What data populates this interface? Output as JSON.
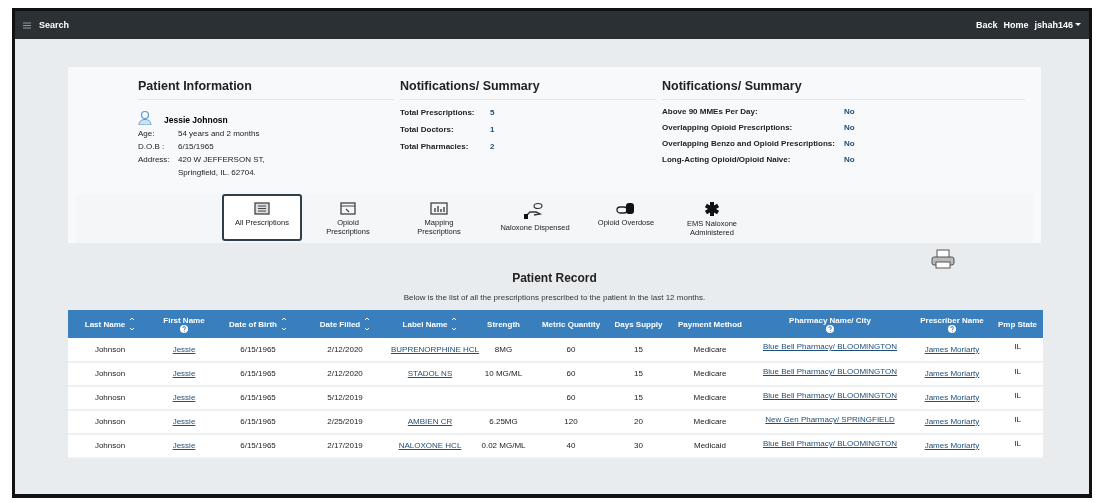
{
  "navbar": {
    "menu_label": "Search",
    "links": [
      "Back",
      "Home"
    ],
    "user": "jshah146"
  },
  "patient": {
    "title": "Patient Information",
    "name": "Jessie Johnosn",
    "fields": [
      {
        "label": "Age:",
        "value": "54 years and 2 months"
      },
      {
        "label": "D.O.B :",
        "value": "6/15/1965"
      },
      {
        "label": "Address:",
        "value": "420 W JEFFERSON ST,",
        "value_2": "Springfield, IL. 62704."
      }
    ]
  },
  "summary": {
    "title": "Notifications/ Summary",
    "items": [
      {
        "label": "Total Prescriptions:",
        "value": "5"
      },
      {
        "label": "Total Doctors:",
        "value": "1"
      },
      {
        "label": "Total Pharmacies:",
        "value": "2"
      }
    ]
  },
  "notifications": {
    "title": "Notifications/ Summary",
    "items": [
      {
        "label": "Above 90 MMEs Per Day:",
        "value": "No"
      },
      {
        "label": "Overlapping Opioid Prescriptions:",
        "value": "No"
      },
      {
        "label": "Overlapping Benzo and Opioid Prescriptions:",
        "value": "No"
      },
      {
        "label": "Long-Acting Opioid/Opioid Naive:",
        "value": "No"
      }
    ]
  },
  "tabs": [
    {
      "kind": "list",
      "label": "All Prescriptions",
      "selected": true
    },
    {
      "kind": "opioid",
      "label": "Opioid Prescriptions",
      "selected": false
    },
    {
      "kind": "map",
      "label": "Mapping Prescriptions",
      "selected": false
    },
    {
      "kind": "naloxone",
      "label": "Naloxone Dispensed",
      "selected": false
    },
    {
      "kind": "overdose",
      "label": "Opioid Overdose",
      "selected": false
    },
    {
      "kind": "ems",
      "label": "EMS Naloxone Administered",
      "selected": false
    }
  ],
  "record": {
    "title": "Patient Record",
    "subtitle": "Below is the list of all the prescriptions prescribed to the patient in the last 12 months."
  },
  "table": {
    "columns": [
      {
        "label": "Last Name",
        "sortable": true,
        "help": false,
        "link": false
      },
      {
        "label": "First Name",
        "sortable": false,
        "help": true,
        "link": true
      },
      {
        "label": "Date of Birth",
        "sortable": true,
        "help": false,
        "link": false
      },
      {
        "label": "Date Filled",
        "sortable": true,
        "help": false,
        "link": false
      },
      {
        "label": "Label Name",
        "sortable": true,
        "help": false,
        "link": true
      },
      {
        "label": "Strength",
        "sortable": false,
        "help": false,
        "link": false
      },
      {
        "label": "Metric Quantity",
        "sortable": false,
        "help": false,
        "link": false
      },
      {
        "label": "Days Supply",
        "sortable": false,
        "help": false,
        "link": false
      },
      {
        "label": "Payment Method",
        "sortable": false,
        "help": false,
        "link": false
      },
      {
        "label": "Pharmacy Name/ City",
        "sortable": false,
        "help": true,
        "link": true
      },
      {
        "label": "Prescriber Name",
        "sortable": false,
        "help": true,
        "link": true
      },
      {
        "label": "Pmp State",
        "sortable": false,
        "help": false,
        "link": false
      }
    ],
    "rows": [
      [
        "Johnson",
        "Jessie",
        "6/15/1965",
        "2/12/2020",
        "BUPRENORPHINE HCL",
        "8MG",
        "60",
        "15",
        "Medicare",
        "Blue Bell Pharmacy/ BLOOMINGTON",
        "James Moriarty",
        "IL"
      ],
      [
        "Johnson",
        "Jessie",
        "6/15/1965",
        "2/12/2020",
        "STADOL NS",
        "10 MG/ML",
        "60",
        "15",
        "Medicare",
        "Blue Bell Pharmacy/ BLOOMINGTON",
        "James Moriarty",
        "IL"
      ],
      [
        "Johnosn",
        "Jessie",
        "6/15/1965",
        "5/12/2019",
        null,
        null,
        "60",
        "15",
        "Medicare",
        "Blue Bell Pharmacy/ BLOOMINGTON",
        "James Moriarty",
        "IL"
      ],
      [
        "Johnson",
        "Jessie",
        "6/15/1965",
        "2/25/2019",
        "AMBIEN CR",
        "6.25MG",
        "120",
        "20",
        "Medicare",
        "New Gen Pharmacy/ SPRINGFIELD",
        "James Moriarty",
        "IL"
      ],
      [
        "Johnson",
        "Jessie",
        "6/15/1965",
        "2/17/2019",
        "NALOXONE HCL",
        "0.02 MG/ML",
        "40",
        "30",
        "Medicaid",
        "Blue Bell Pharmacy/ BLOOMINGTON",
        "James Moriarty",
        "IL"
      ]
    ]
  }
}
